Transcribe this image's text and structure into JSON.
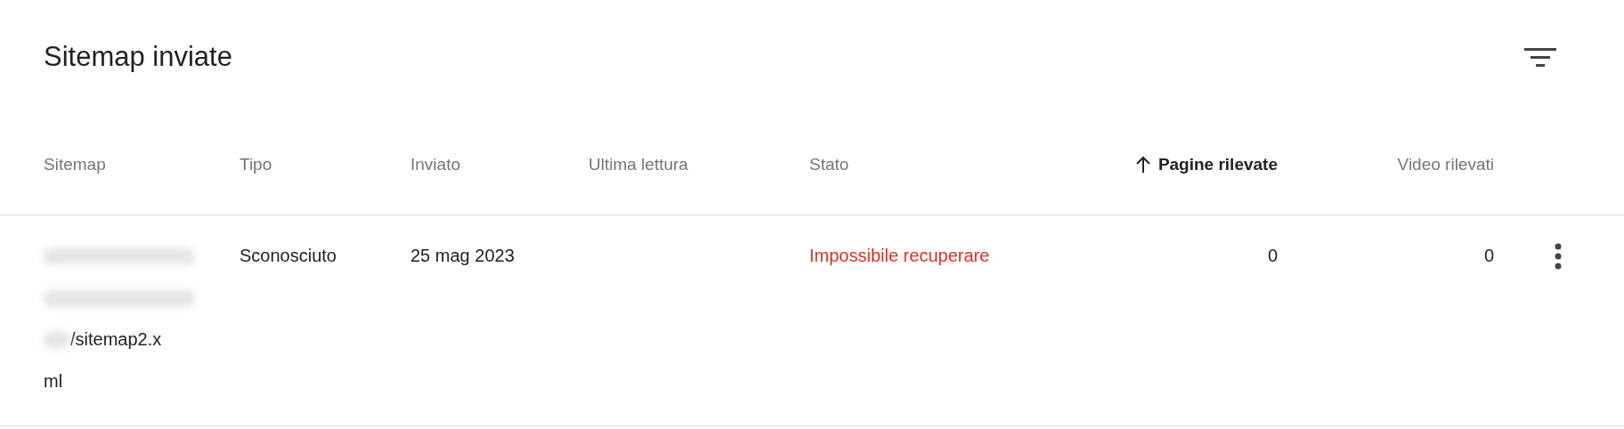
{
  "card": {
    "title": "Sitemap inviate"
  },
  "table": {
    "columns": [
      {
        "label": "Sitemap",
        "sorted": false
      },
      {
        "label": "Tipo",
        "sorted": false
      },
      {
        "label": "Inviato",
        "sorted": false
      },
      {
        "label": "Ultima lettura",
        "sorted": false
      },
      {
        "label": "Stato",
        "sorted": false
      },
      {
        "label": "Pagine rilevate",
        "sorted": true
      },
      {
        "label": "Video rilevati",
        "sorted": false
      }
    ],
    "rows": [
      {
        "sitemap_lines": [
          "/sitemap2.x",
          "ml"
        ],
        "type": "Sconosciuto",
        "submitted": "25 mag 2023",
        "status": "Impossibile recuperare",
        "status_error": true,
        "pages": "0",
        "videos": "0"
      }
    ]
  }
}
